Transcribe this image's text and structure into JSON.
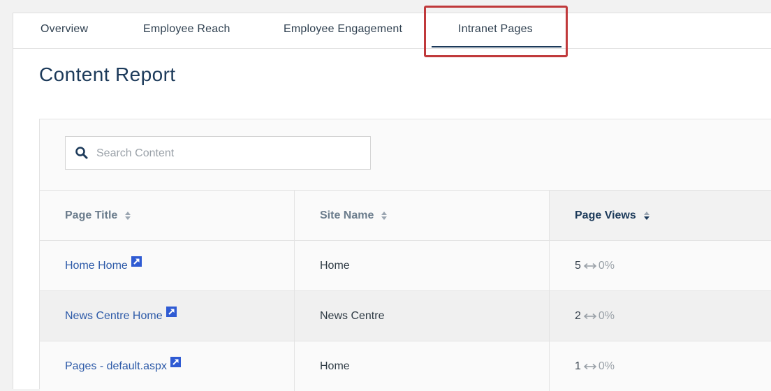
{
  "tabs": [
    {
      "label": "Overview"
    },
    {
      "label": "Employee Reach"
    },
    {
      "label": "Employee Engagement"
    },
    {
      "label": "Intranet Pages",
      "active": true
    }
  ],
  "page_title": "Content Report",
  "search": {
    "placeholder": "Search Content",
    "value": ""
  },
  "table": {
    "columns": [
      "Page Title",
      "Site Name",
      "Page Views"
    ],
    "rows": [
      {
        "title": "Home Home",
        "site": "Home",
        "views": "5",
        "change": "0%"
      },
      {
        "title": "News Centre Home",
        "site": "News Centre",
        "views": "2",
        "change": "0%"
      },
      {
        "title": "Pages - default.aspx",
        "site": "Home",
        "views": "1",
        "change": "0%"
      }
    ]
  },
  "colors": {
    "accent": "#1c3a5a",
    "link": "#2d5aa8",
    "highlight": "#c0393b",
    "external_link_icon": "#2f5bd3"
  },
  "icons": {
    "search": "search-icon",
    "sort": "sort-icon",
    "external_link": "external-link-icon",
    "change": "left-right-arrow-icon"
  }
}
